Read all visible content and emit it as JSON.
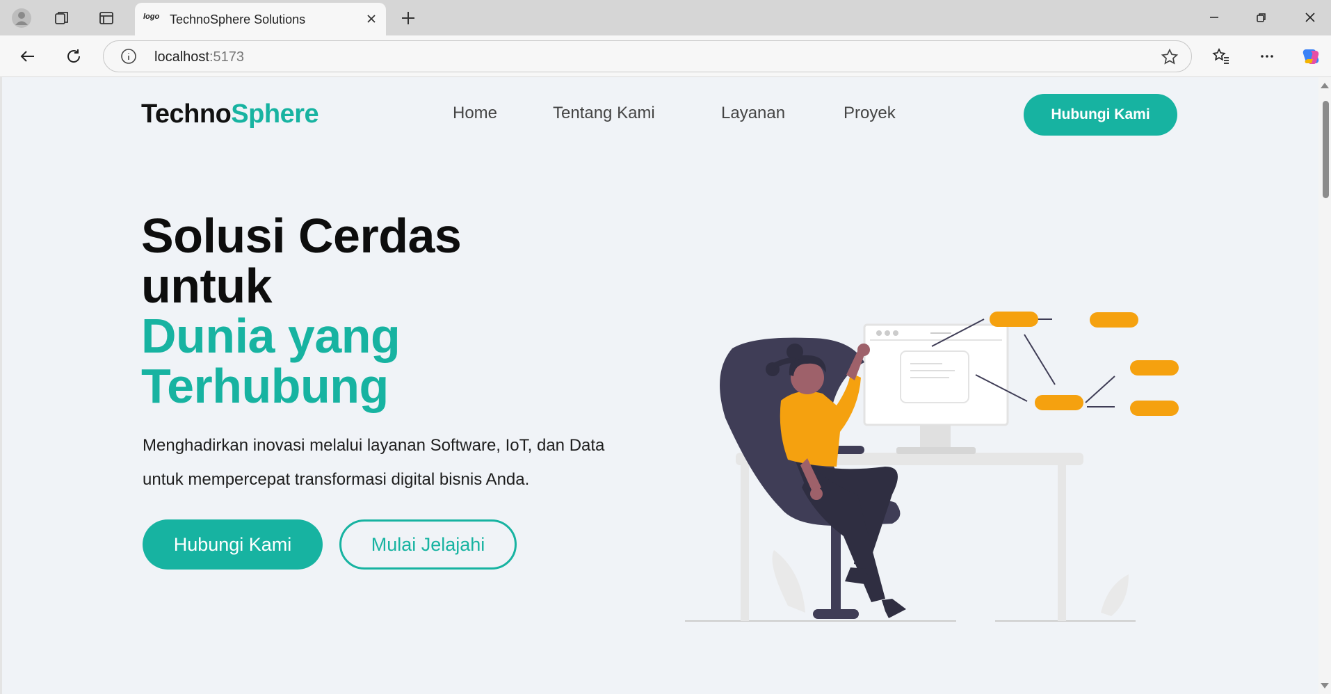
{
  "browser": {
    "tab_title": "TechnoSphere Solutions",
    "tab_favicon": "logo",
    "url_host": "localhost",
    "url_port": ":5173",
    "icons": [
      "profile-icon",
      "workspaces-icon",
      "tab-actions-icon",
      "close-icon",
      "new-tab-icon",
      "minimize-icon",
      "restore-icon",
      "window-close-icon",
      "back-icon",
      "refresh-icon",
      "info-icon",
      "star-icon",
      "favorites-icon",
      "more-icon",
      "copilot-icon"
    ]
  },
  "site": {
    "logo_part1": "Techno",
    "logo_part2": "Sphere",
    "nav": [
      "Home",
      "Tentang Kami",
      "Layanan",
      "Proyek"
    ],
    "cta_top": "Hubungi Kami"
  },
  "hero": {
    "title_line1": "Solusi Cerdas",
    "title_line2": "untuk",
    "title_line3": "Dunia yang",
    "title_line4": "Terhubung",
    "description": "Menghadirkan inovasi melalui layanan Software, IoT, dan Data untuk mempercepat transformasi digital bisnis Anda.",
    "btn_primary": "Hubungi Kami",
    "btn_secondary": "Mulai Jelajahi"
  },
  "colors": {
    "accent": "#17b3a1",
    "orange": "#f5a10f",
    "dark": "#3f3d56"
  }
}
